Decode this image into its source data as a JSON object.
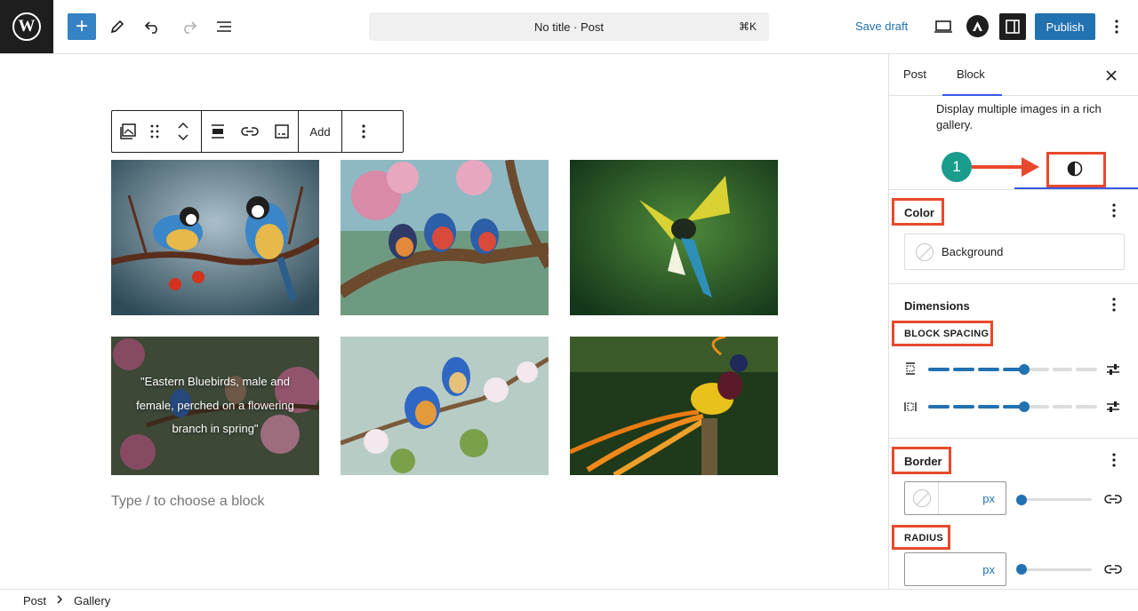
{
  "topbar": {
    "logo_letter": "W",
    "title": "No title · Post",
    "shortcut": "⌘K",
    "save_draft": "Save draft",
    "publish": "Publish",
    "add_block": "+"
  },
  "toolbar": {
    "add_label": "Add"
  },
  "gallery": {
    "caption": "\"Eastern Bluebirds, male and female, perched on a flowering branch in spring\"",
    "placeholder": "Type / to choose a block"
  },
  "sidebar": {
    "tabs": [
      "Post",
      "Block"
    ],
    "active_tab": "Block",
    "description": "Display multiple images in a rich gallery.",
    "step_number": "1",
    "color": {
      "heading": "Color",
      "background_label": "Background"
    },
    "dimensions": {
      "heading": "Dimensions",
      "block_spacing_label": "BLOCK SPACING"
    },
    "border": {
      "heading": "Border",
      "unit": "px",
      "radius_label": "RADIUS",
      "radius_unit": "px"
    }
  },
  "footer": {
    "breadcrumb": [
      "Post",
      "Gallery"
    ]
  },
  "colors": {
    "accent": "#2271b1",
    "highlight": "#e8492c",
    "badge": "#1a9c8c"
  }
}
